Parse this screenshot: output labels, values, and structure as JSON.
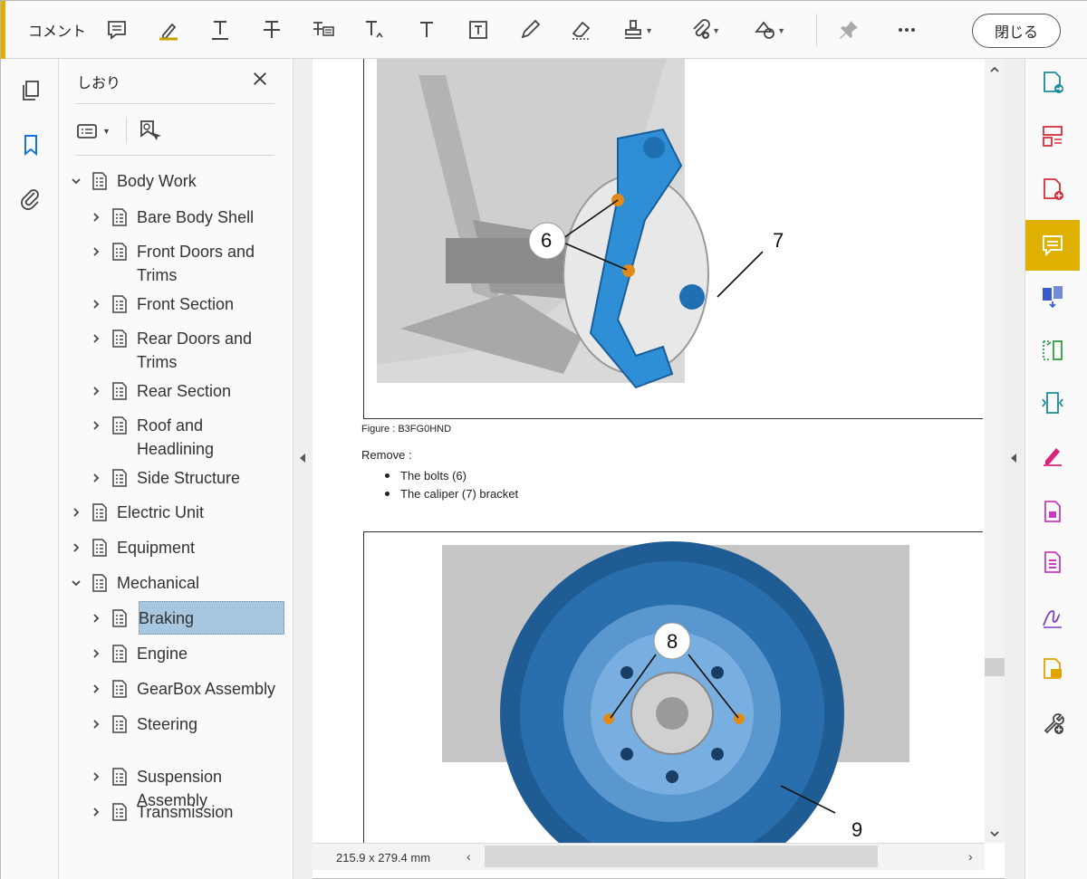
{
  "toolbar": {
    "mode_label": "コメント",
    "close_label": "閉じる",
    "tools": [
      {
        "icon": "sticky-note-icon"
      },
      {
        "icon": "highlight-icon"
      },
      {
        "icon": "underline-text-icon"
      },
      {
        "icon": "strikethrough-text-icon"
      },
      {
        "icon": "replace-text-icon"
      },
      {
        "icon": "insert-text-icon"
      },
      {
        "icon": "add-text-comment-icon"
      },
      {
        "icon": "text-box-icon"
      },
      {
        "icon": "pencil-icon"
      },
      {
        "icon": "eraser-icon"
      },
      {
        "icon": "stamp-icon"
      },
      {
        "icon": "attach-file-icon"
      },
      {
        "icon": "shapes-icon"
      },
      {
        "icon": "pin-icon"
      },
      {
        "icon": "more-icon"
      }
    ]
  },
  "left_rail": {
    "items": [
      {
        "icon": "pages-icon",
        "active": false
      },
      {
        "icon": "bookmark-icon",
        "active": true
      },
      {
        "icon": "attachment-icon",
        "active": false
      }
    ]
  },
  "bookmarks": {
    "title": "しおり",
    "items": [
      {
        "label": "Body Work",
        "level": 0,
        "expanded": true
      },
      {
        "label": "Bare Body Shell",
        "level": 1,
        "expanded": false
      },
      {
        "label": "Front Doors and",
        "label2": "Trims",
        "level": 1,
        "expanded": false
      },
      {
        "label": "Front Section",
        "level": 1,
        "expanded": false
      },
      {
        "label": "Rear Doors and",
        "label2": "Trims",
        "level": 1,
        "expanded": false
      },
      {
        "label": "Rear Section",
        "level": 1,
        "expanded": false
      },
      {
        "label": "Roof and",
        "label2": "Headlining",
        "level": 1,
        "expanded": false
      },
      {
        "label": "Side Structure",
        "level": 1,
        "expanded": false
      },
      {
        "label": "Electric Unit",
        "level": 0,
        "expanded": false
      },
      {
        "label": "Equipment",
        "level": 0,
        "expanded": false
      },
      {
        "label": "Mechanical",
        "level": 0,
        "expanded": true
      },
      {
        "label": "Braking",
        "level": 1,
        "expanded": false,
        "selected": true
      },
      {
        "label": "Engine",
        "level": 1,
        "expanded": false
      },
      {
        "label": "GearBox Assembly",
        "level": 1,
        "expanded": false
      },
      {
        "label": "Steering",
        "level": 1,
        "expanded": false
      },
      {
        "label": "Suspension",
        "label2": "Assembly",
        "level": 1,
        "expanded": false
      },
      {
        "label": "Transmission",
        "level": 1,
        "expanded": false
      }
    ]
  },
  "document": {
    "figure1_callouts": {
      "a": "6",
      "b": "7"
    },
    "figure_caption": "Figure : B3FG0HND",
    "remove_heading": "Remove :",
    "remove_items": [
      "The bolts (6)",
      "The caliper (7) bracket"
    ],
    "figure2_callouts": {
      "a": "8",
      "b": "9"
    }
  },
  "statusbar": {
    "page_size": "215.9 x 279.4 mm"
  },
  "right_rail": {
    "accent": "#e0b000",
    "items": [
      {
        "icon": "export-pdf-icon",
        "color": "#1a8c9e"
      },
      {
        "icon": "organize-pages-icon",
        "color": "#d62e3a"
      },
      {
        "icon": "create-pdf-icon",
        "color": "#d62e3a"
      },
      {
        "icon": "comment-icon",
        "color": "#ffffff",
        "active": true
      },
      {
        "icon": "combine-files-icon",
        "color": "#3a5cc9"
      },
      {
        "icon": "compare-files-icon",
        "color": "#2f9e44"
      },
      {
        "icon": "optimize-pdf-icon",
        "color": "#1a8c9e"
      },
      {
        "icon": "fill-sign-icon",
        "color": "#d9247e"
      },
      {
        "icon": "protect-icon",
        "color": "#c83cc1"
      },
      {
        "icon": "redact-icon",
        "color": "#c83cc1"
      },
      {
        "icon": "request-signature-icon",
        "color": "#7b3fc4"
      },
      {
        "icon": "send-comments-icon",
        "color": "#e0a400"
      },
      {
        "icon": "more-tools-icon",
        "color": "#444444"
      }
    ]
  }
}
